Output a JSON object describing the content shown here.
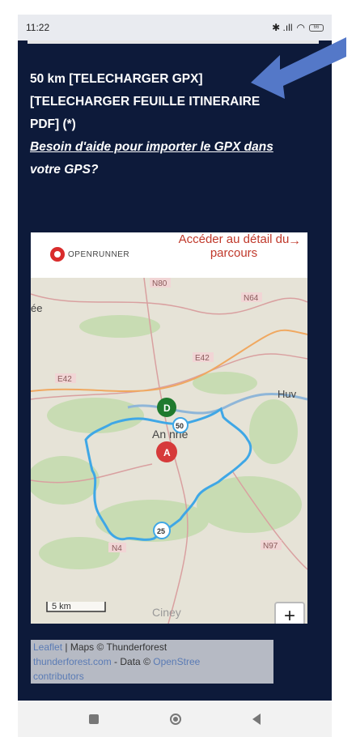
{
  "status": {
    "time": "11:22",
    "icons": "✱ .ıll ",
    "battery": "66"
  },
  "content": {
    "line1": "50 km [TELECHARGER GPX]",
    "line2": "[TELECHARGER FEUILLE ITINERAIRE",
    "line3": "PDF] (*)",
    "help_link": "Besoin d'aide pour importer le GPX dans",
    "help_rest": "votre GPS?"
  },
  "map": {
    "brand": "OPENRUNNER",
    "detail_link": "Accéder au détail du parcours",
    "detail_arrow": "→",
    "labels": {
      "n80": "N80",
      "n64": "N64",
      "n42": "E42",
      "e42b": "E42",
      "n4": "N4",
      "n97": "N97",
      "huy": "Huv",
      "ee": "ée",
      "andenne": "An  nne",
      "ciney": "Ciney"
    },
    "marker_d": "D",
    "marker_a": "A",
    "km_50": "50",
    "km_25": "25",
    "scale": "5 km",
    "zoom_in": "+",
    "zoom_out": "−",
    "colors": {
      "route": "#3fa7e6",
      "start": "#1f7a2e",
      "end": "#d63a3a",
      "background": "#0d1a3a"
    }
  },
  "attribution": {
    "leaflet": "Leaflet",
    "maps": " | Maps © Thunderforest",
    "tf_link": "thunderforest.com",
    "data": " - Data © ",
    "osm": "OpenStree",
    "contributors": "contributors"
  }
}
